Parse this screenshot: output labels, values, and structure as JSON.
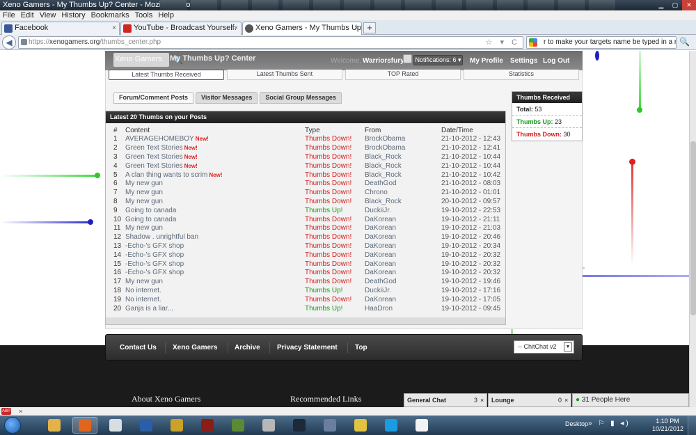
{
  "window": {
    "title": "Xeno Gamers - My Thumbs Up? Center - Mozilla Firefox"
  },
  "menu": [
    "File",
    "Edit",
    "View",
    "History",
    "Bookmarks",
    "Tools",
    "Help"
  ],
  "tabs": [
    {
      "label": "Facebook",
      "icon_color": "#3b5998",
      "close": "×"
    },
    {
      "label": "YouTube - Broadcast Yourself.",
      "icon_color": "#d0261e",
      "close": "×"
    },
    {
      "label": "Xeno Gamers - My Thumbs Up? Center",
      "icon_color": "#555555",
      "close": "×"
    }
  ],
  "new_tab_label": "+",
  "nav": {
    "back_icon": "◀",
    "url_prefix": "https://",
    "url_host": "xenogamers.org",
    "url_path": "/thumbs_center.php",
    "url_icons": "☆ ▾ C",
    "search_text": "r to make your targets name be typed in a macro",
    "search_icon": "🔍"
  },
  "site": {
    "logo_text": "Xeno Gamers",
    "search_icon": "🔍",
    "page_title": "My Thumbs Up? Center",
    "welcome": "Welcome,",
    "username": "Warriorsfury",
    "notifications": "Notifications: 6 ▾",
    "links": [
      "My Profile",
      "Settings",
      "Log Out"
    ]
  },
  "subnav": [
    "Latest Thumbs Received",
    "Latest Thumbs Sent",
    "TOP Rated",
    "Statistics"
  ],
  "post_tabs": [
    "Forum/Comment Posts",
    "Visitor Messages",
    "Social Group Messages"
  ],
  "panel": {
    "title": "Latest 20 Thumbs on your Posts",
    "headers": {
      "num": "#",
      "content": "Content",
      "type": "Type",
      "from": "From",
      "date": "Date/Time"
    },
    "new_badge": "New!",
    "rows": [
      {
        "num": "1",
        "content": "AVERAGEHOMEBOY",
        "new": true,
        "type": "Thumbs Down!",
        "from": "BrockObama",
        "date": "21-10-2012 - 12:43"
      },
      {
        "num": "2",
        "content": "Green Text Stories",
        "new": true,
        "type": "Thumbs Down!",
        "from": "BrockObama",
        "date": "21-10-2012 - 12:41"
      },
      {
        "num": "3",
        "content": "Green Text Stories",
        "new": true,
        "type": "Thumbs Down!",
        "from": "Black_Rock",
        "date": "21-10-2012 - 10:44"
      },
      {
        "num": "4",
        "content": "Green Text Stories",
        "new": true,
        "type": "Thumbs Down!",
        "from": "Black_Rock",
        "date": "21-10-2012 - 10:44"
      },
      {
        "num": "5",
        "content": "A clan thing wants to scrim",
        "new": true,
        "type": "Thumbs Down!",
        "from": "Black_Rock",
        "date": "21-10-2012 - 10:42"
      },
      {
        "num": "6",
        "content": "My new gun",
        "new": false,
        "type": "Thumbs Down!",
        "from": "DeathGod",
        "date": "21-10-2012 - 08:03"
      },
      {
        "num": "7",
        "content": "My new gun",
        "new": false,
        "type": "Thumbs Down!",
        "from": "Chrono",
        "date": "21-10-2012 - 01:01"
      },
      {
        "num": "8",
        "content": "My new gun",
        "new": false,
        "type": "Thumbs Down!",
        "from": "Black_Rock",
        "date": "20-10-2012 - 09:57"
      },
      {
        "num": "9",
        "content": "Going to canada",
        "new": false,
        "type": "Thumbs Up!",
        "from": "DuckiiJr.",
        "date": "19-10-2012 - 22:53"
      },
      {
        "num": "10",
        "content": "Going to canada",
        "new": false,
        "type": "Thumbs Down!",
        "from": "DaKorean",
        "date": "19-10-2012 - 21:11"
      },
      {
        "num": "11",
        "content": "My new gun",
        "new": false,
        "type": "Thumbs Down!",
        "from": "DaKorean",
        "date": "19-10-2012 - 21:03"
      },
      {
        "num": "12",
        "content": "Shadow . unrightful ban",
        "new": false,
        "type": "Thumbs Down!",
        "from": "DaKorean",
        "date": "19-10-2012 - 20:46"
      },
      {
        "num": "13",
        "content": "-Echo-'s GFX shop",
        "new": false,
        "type": "Thumbs Down!",
        "from": "DaKorean",
        "date": "19-10-2012 - 20:34"
      },
      {
        "num": "14",
        "content": "-Echo-'s GFX shop",
        "new": false,
        "type": "Thumbs Down!",
        "from": "DaKorean",
        "date": "19-10-2012 - 20:32"
      },
      {
        "num": "15",
        "content": "-Echo-'s GFX shop",
        "new": false,
        "type": "Thumbs Down!",
        "from": "DaKorean",
        "date": "19-10-2012 - 20:32"
      },
      {
        "num": "16",
        "content": "-Echo-'s GFX shop",
        "new": false,
        "type": "Thumbs Down!",
        "from": "DaKorean",
        "date": "19-10-2012 - 20:32"
      },
      {
        "num": "17",
        "content": "My new gun",
        "new": false,
        "type": "Thumbs Down!",
        "from": "DeathGod",
        "date": "19-10-2012 - 19:46"
      },
      {
        "num": "18",
        "content": "No internet.",
        "new": false,
        "type": "Thumbs Up!",
        "from": "DuckiiJr.",
        "date": "19-10-2012 - 17:16"
      },
      {
        "num": "19",
        "content": "No internet.",
        "new": false,
        "type": "Thumbs Down!",
        "from": "DaKorean",
        "date": "19-10-2012 - 17:05"
      },
      {
        "num": "20",
        "content": "Ganja is a liar...",
        "new": false,
        "type": "Thumbs Up!",
        "from": "HaaDron",
        "date": "19-10-2012 - 09:45"
      }
    ]
  },
  "sidebox": {
    "title": "Thumbs Received",
    "total_label": "Total:",
    "total": "53",
    "up_label": "Thumbs Up:",
    "up": "23",
    "down_label": "Thumbs Down:",
    "down": "30"
  },
  "footer": {
    "links": [
      "Contact Us",
      "Xeno Gamers",
      "Archive",
      "Privacy Statement",
      "Top"
    ],
    "style_select": "-- ChitChat v2",
    "select_arrow": "▼",
    "about_heading": "About Xeno Gamers",
    "links_heading": "Recommended Links"
  },
  "chat": {
    "general_label": "General Chat",
    "general_count": "3",
    "lounge_label": "Lounge",
    "lounge_count": "0",
    "people": "31 People Here",
    "close": "×",
    "online_dot": "●"
  },
  "findbar": {
    "badge": "ABP",
    "close": "×"
  },
  "taskbar": {
    "apps": [
      {
        "name": "explorer",
        "color": "#e3b34a"
      },
      {
        "name": "firefox",
        "color": "#e0661d",
        "active": true
      },
      {
        "name": "helmet",
        "color": "#d8dde2"
      },
      {
        "name": "lol",
        "color": "#2a5ea8"
      },
      {
        "name": "wow",
        "color": "#c9a227"
      },
      {
        "name": "diablo",
        "color": "#8a1e16"
      },
      {
        "name": "minecraft",
        "color": "#5c8a32"
      },
      {
        "name": "folder-app",
        "color": "#b7b7b7"
      },
      {
        "name": "steam",
        "color": "#1d2838"
      },
      {
        "name": "media-app",
        "color": "#6a7fa0"
      },
      {
        "name": "tool-app",
        "color": "#e2c340"
      },
      {
        "name": "skype",
        "color": "#1b9ce2"
      },
      {
        "name": "cs-app",
        "color": "#f2f2f2"
      }
    ],
    "desktop_label": "Desktop",
    "tray_icons": "» ⚐ ▮ ◂)",
    "time": "1:10 PM",
    "date": "10/21/2012"
  },
  "colors": {
    "thumbs_down": "#d81a1a",
    "thumbs_up": "#1a9a1a",
    "new_badge": "#e02020"
  }
}
